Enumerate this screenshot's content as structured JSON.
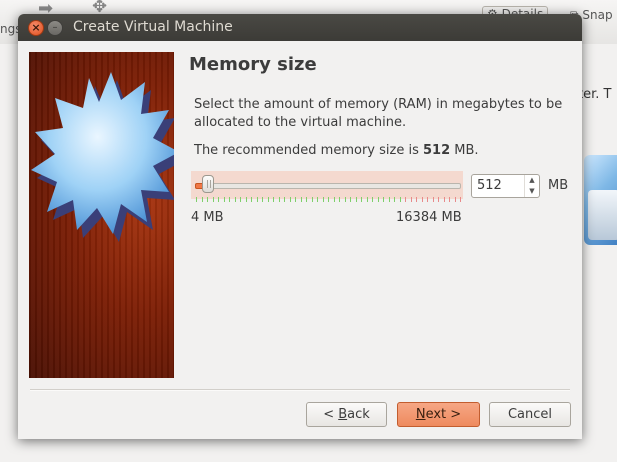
{
  "background_window": {
    "toolbar_fragments": [
      "ngs",
      "Details",
      "Snap"
    ],
    "side_text": "ter. T"
  },
  "dialog": {
    "title": "Create Virtual Machine",
    "heading": "Memory size",
    "description": "Select the amount of memory (RAM) in megabytes to be allocated to the virtual machine.",
    "recommend_prefix": "The recommended memory size is ",
    "recommended_value": "512",
    "recommend_suffix": " MB.",
    "memory": {
      "value": "512",
      "unit": "MB",
      "min_label": "4 MB",
      "max_label": "16384 MB",
      "min": 4,
      "max": 16384,
      "current": 512
    },
    "buttons": {
      "back": "< Back",
      "back_mnemonic": "B",
      "next": "Next >",
      "next_mnemonic": "N",
      "cancel": "Cancel"
    }
  },
  "colors": {
    "accent": "#f07746",
    "titlebar": "#3c3b37",
    "banner": "#7d1e05",
    "tick_green": "#7fcf6a",
    "tick_red": "#e88a8a"
  }
}
